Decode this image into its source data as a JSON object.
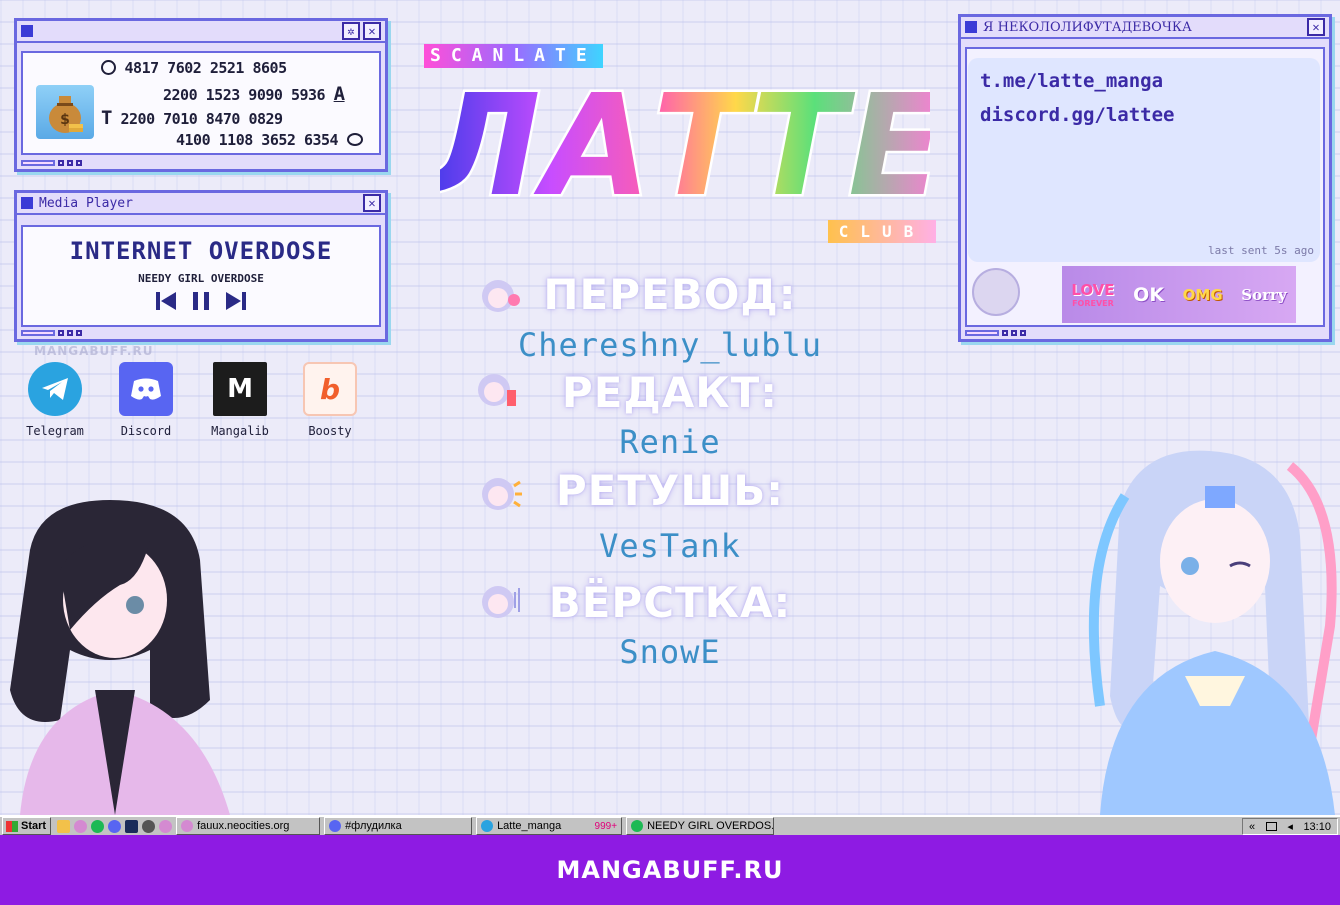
{
  "payment_window": {
    "lines": [
      {
        "number": "4817 7602 2521 8605",
        "icon": "sber-icon"
      },
      {
        "number": "2200 1523 9090 5936",
        "icon": "alfa-icon"
      },
      {
        "number": "2200 7010 8470 0829",
        "icon": "tbank-icon"
      },
      {
        "number": "4100 1108 3652 6354",
        "icon": "yoomoney-icon"
      }
    ]
  },
  "media_player": {
    "title": "Media Player",
    "track": "INTERNET OVERDOSE",
    "artist": "NEEDY GIRL OVERDOSE"
  },
  "watermark_small": "MANGABUFF.RU",
  "desktop_icons": [
    {
      "label": "Telegram",
      "color": "#2aa3e0"
    },
    {
      "label": "Discord",
      "color": "#5865f2"
    },
    {
      "label": "Mangalib",
      "color": "#1c1c1c"
    },
    {
      "label": "Boosty",
      "color": "#f15f2c"
    }
  ],
  "logo": {
    "top_tag": "SCANLATE",
    "main": "ЛАТТЕ",
    "bottom_tag": "CLUB"
  },
  "credits": [
    {
      "role": "ПЕРЕВОД:",
      "name": "Chereshny_lublu"
    },
    {
      "role": "РЕДАКТ:",
      "name": "Renie"
    },
    {
      "role": "РЕТУШЬ:",
      "name": "VesTank"
    },
    {
      "role": "ВЁРСТКА:",
      "name": "SnowE"
    }
  ],
  "chat_window": {
    "title": "Я НЕКОЛОЛИФУТАДЕВОЧКА",
    "lines": [
      "t.me/latte_manga",
      "discord.gg/lattee"
    ],
    "meta": "last sent 5s ago",
    "stickers": [
      "LOVE",
      "OK",
      "OMG",
      "Sorry"
    ],
    "sticker_sub": "FOREVER"
  },
  "taskbar": {
    "start": "Start",
    "tasks": [
      {
        "label": "fauux.neocities.org",
        "color": "#d48ad1"
      },
      {
        "label": "#флудилка",
        "color": "#5865f2"
      },
      {
        "label": "Latte_manga",
        "color": "#2aa3e0",
        "badge": "999+"
      },
      {
        "label": "NEEDY GIRL OVERDOS...",
        "color": "#1db954"
      }
    ],
    "clock": "13:10"
  },
  "footer": "MANGABUFF.RU"
}
